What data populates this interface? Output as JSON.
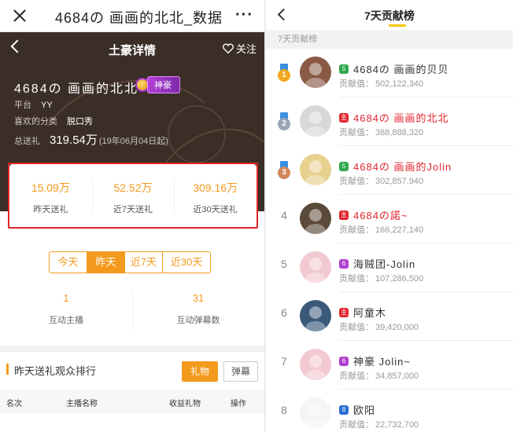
{
  "left": {
    "topbar": {
      "title": "4684の 画画的北北_数据",
      "more": "···"
    },
    "hero": {
      "page_title": "土豪详情",
      "follow_label": "关注",
      "name": "4684の 画画的北北",
      "badge": "神豪",
      "platform_label": "平台",
      "platform_value": "YY",
      "category_label": "喜欢的分类",
      "category_value": "脱口秀",
      "total_label": "总送礼",
      "total_value": "319.54万",
      "since": "(19年06月04日起)"
    },
    "stats": [
      {
        "value": "15.09万",
        "label": "昨天送礼"
      },
      {
        "value": "52.52万",
        "label": "近7天送礼"
      },
      {
        "value": "309.16万",
        "label": "近30天送礼"
      }
    ],
    "periods": [
      {
        "label": "今天",
        "active": false
      },
      {
        "label": "昨天",
        "active": true
      },
      {
        "label": "近7天",
        "active": false
      },
      {
        "label": "近30天",
        "active": false
      }
    ],
    "counts": [
      {
        "value": "1",
        "label": "互动主播"
      },
      {
        "value": "31",
        "label": "互动弹幕数"
      }
    ],
    "ranking": {
      "title": "昨天送礼观众排行",
      "btn_gift": "礼物",
      "btn_danmu": "弹幕",
      "columns": [
        "名次",
        "主播名称",
        "收益礼物",
        "操作"
      ]
    }
  },
  "right": {
    "title": "7天贡献榜",
    "subtitle": "7天贡献榜",
    "value_label": "贡献值：",
    "items": [
      {
        "rank": "1",
        "name": "4684の 画画的贝贝",
        "value": "502,122,340",
        "level": "5",
        "red": false,
        "level_color": "#2fa84f",
        "medal": "gold"
      },
      {
        "rank": "2",
        "name": "4684の 画画的北北",
        "value": "388,888,320",
        "level": "主",
        "red": true,
        "level_color": "#e3232c",
        "medal": "silver"
      },
      {
        "rank": "3",
        "name": "4684の 画画的Jolin",
        "value": "302,857,940",
        "level": "5",
        "red": true,
        "level_color": "#2fa84f",
        "medal": "bronze"
      },
      {
        "rank": "4",
        "name": "4684の諾~",
        "value": "166,227,140",
        "level": "主",
        "red": true,
        "level_color": "#e3232c",
        "medal": ""
      },
      {
        "rank": "5",
        "name": "海贼团-Jolin",
        "value": "107,286,500",
        "level": "6",
        "red": false,
        "level_color": "#b040d0",
        "medal": ""
      },
      {
        "rank": "6",
        "name": "阿童木",
        "value": "39,420,000",
        "level": "主",
        "red": false,
        "level_color": "#e3232c",
        "medal": ""
      },
      {
        "rank": "7",
        "name": "神豪 Jolin~",
        "value": "34,857,000",
        "level": "6",
        "red": false,
        "level_color": "#b040d0",
        "medal": ""
      },
      {
        "rank": "8",
        "name": "欧阳",
        "value": "22,732,700",
        "level": "8",
        "red": false,
        "level_color": "#2a6fd6",
        "medal": ""
      }
    ]
  }
}
